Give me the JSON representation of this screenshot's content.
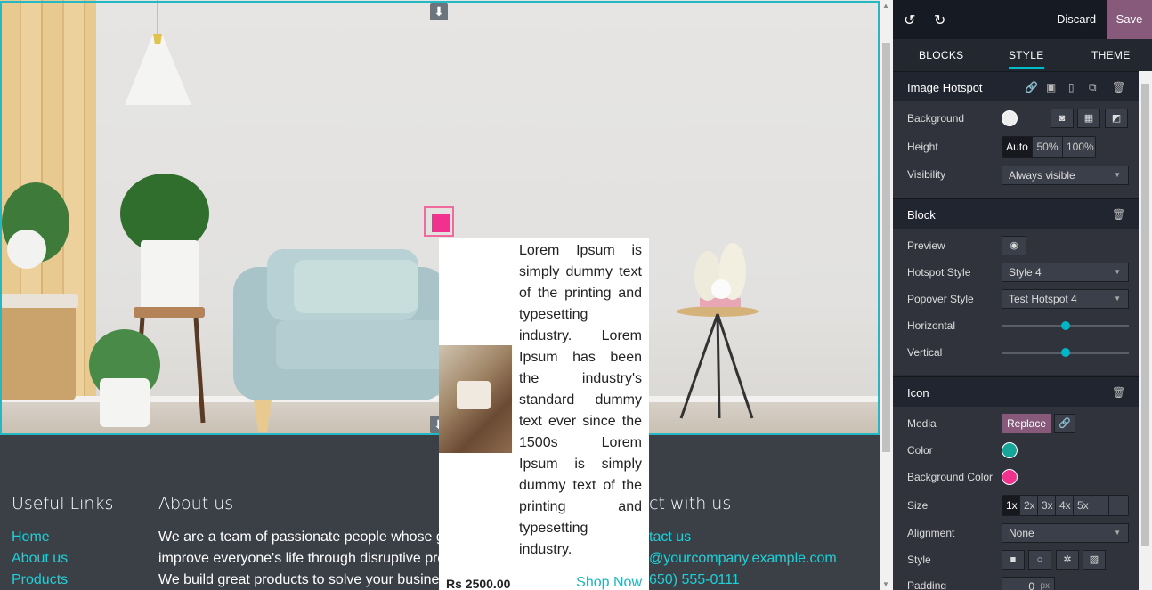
{
  "editor": {
    "undo_icon": "undo-icon",
    "redo_icon": "redo-icon",
    "discard": "Discard",
    "save": "Save",
    "tabs": [
      "BLOCKS",
      "STYLE",
      "THEME"
    ],
    "active_tab": "STYLE"
  },
  "sections": {
    "image_hotspot": {
      "title": "Image Hotspot",
      "background_label": "Background",
      "height_label": "Height",
      "height_options": [
        "Auto",
        "50%",
        "100%"
      ],
      "visibility_label": "Visibility",
      "visibility_value": "Always visible"
    },
    "block": {
      "title": "Block",
      "preview_label": "Preview",
      "hotspot_style_label": "Hotspot Style",
      "hotspot_style_value": "Style 4",
      "popover_style_label": "Popover Style",
      "popover_style_value": "Test Hotspot 4",
      "horizontal_label": "Horizontal",
      "horizontal_value": 0.5,
      "vertical_label": "Vertical",
      "vertical_value": 0.5
    },
    "icon": {
      "title": "Icon",
      "media_label": "Media",
      "replace": "Replace",
      "color_label": "Color",
      "color_value": "#17a59a",
      "bg_color_label": "Background Color",
      "bg_color_value": "#f1318e",
      "size_label": "Size",
      "size_options": [
        "1x",
        "2x",
        "3x",
        "4x",
        "5x",
        "",
        ""
      ],
      "alignment_label": "Alignment",
      "alignment_value": "None",
      "style_label": "Style",
      "padding_label": "Padding",
      "padding_value": "0",
      "padding_unit": "px"
    }
  },
  "popover": {
    "text": "Lorem Ipsum is simply dummy text of the printing and typesetting industry. Lorem Ipsum has been the industry's standard dummy text ever since the 1500s Lorem Ipsum is simply dummy text of the printing and typesetting industry.",
    "price": "Rs 2500.00",
    "shop": "Shop Now"
  },
  "footer": {
    "useful_links_title": "Useful Links",
    "links": [
      "Home",
      "About us",
      "Products"
    ],
    "about_title": "About us",
    "about_lines": [
      "We are a team of passionate people whose g",
      "improve everyone's life through disruptive pro",
      "We build great products to solve your busine"
    ],
    "connect_title": "ct with us",
    "contact": [
      "tact us",
      "@yourcompany.example.com",
      "650) 555-0111"
    ]
  },
  "colors": {
    "accent": "#00bbca",
    "save": "#875a7b",
    "hotspot": "#f1318e",
    "link": "#1ed0d8"
  }
}
